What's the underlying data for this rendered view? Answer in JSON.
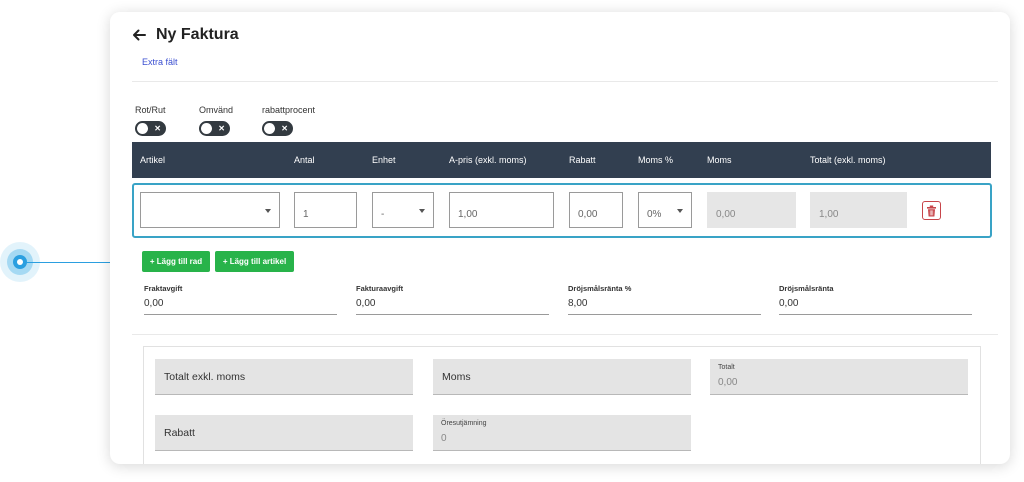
{
  "header": {
    "title": "Ny Faktura",
    "back_icon": "arrow-left-icon"
  },
  "extra_link": "Extra fält",
  "toggles": [
    {
      "label": "Rot/Rut",
      "on": false
    },
    {
      "label": "Omvänd",
      "on": false
    },
    {
      "label": "rabattprocent",
      "on": false
    }
  ],
  "table": {
    "columns": [
      "Artikel",
      "Antal",
      "Enhet",
      "A-pris (exkl. moms)",
      "Rabatt",
      "Moms %",
      "Moms",
      "Totalt (exkl. moms)"
    ],
    "row": {
      "artikel": "",
      "antal": "1",
      "enhet": "-",
      "apris": "1,00",
      "rabatt": "0,00",
      "moms_pct": "0%",
      "moms": "0,00",
      "totalt": "1,00"
    },
    "delete_icon": "trash-icon"
  },
  "buttons": {
    "add_row": "+ Lägg till rad",
    "add_article": "+ Lägg till artikel"
  },
  "fields": [
    {
      "label": "Fraktavgift",
      "value": "0,00"
    },
    {
      "label": "Fakturaavgift",
      "value": "0,00"
    },
    {
      "label": "Dröjsmålsränta %",
      "value": "8,00"
    },
    {
      "label": "Dröjsmålsränta",
      "value": "0,00"
    }
  ],
  "summary": {
    "totalt_exkl_moms": "Totalt exkl. moms",
    "moms": "Moms",
    "totalt_label": "Totalt",
    "totalt_value": "0,00",
    "rabatt": "Rabatt",
    "oresutjamning_label": "Öresutjämning",
    "oresutjamning_value": "0"
  },
  "colors": {
    "table_header": "#323f50",
    "accent_border": "#39a3c6",
    "button_green": "#28b34a",
    "pointer": "#2b9fe0",
    "delete_red": "#c7454a"
  }
}
